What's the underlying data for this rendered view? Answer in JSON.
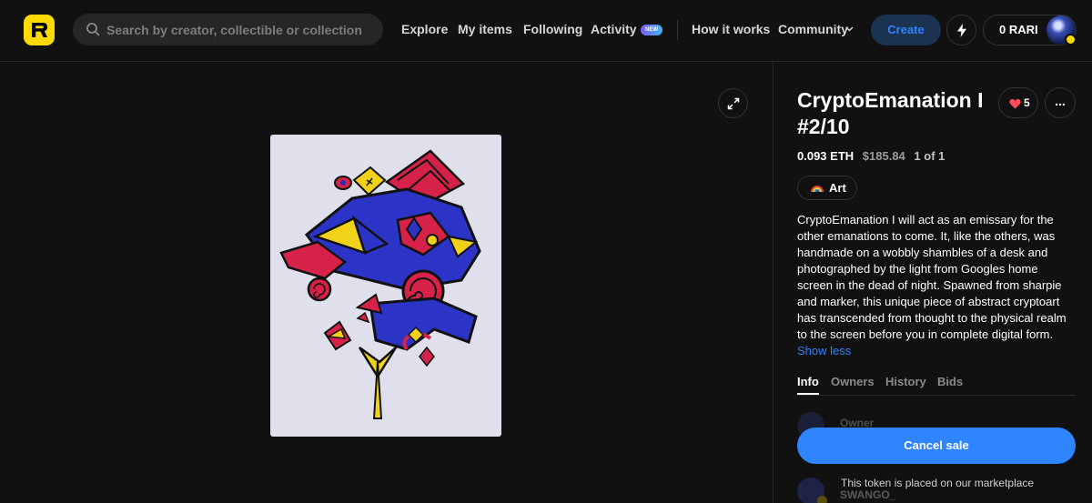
{
  "header": {
    "logo_icon": "rarible-logo-icon",
    "search": {
      "placeholder": "Search by creator, collectible or collection",
      "value": ""
    },
    "nav": {
      "explore": "Explore",
      "my_items": "My items",
      "following": "Following",
      "activity": "Activity",
      "activity_badge": "NEW",
      "how_it_works": "How it works",
      "community": "Community"
    },
    "create_label": "Create",
    "balance": "0 RARI"
  },
  "item": {
    "title": "CryptoEmanation I #2/10",
    "likes": "5",
    "more_label": "...",
    "price_eth": "0.093 ETH",
    "price_usd": "$185.84",
    "edition": "1 of 1",
    "category": "Art",
    "description": "CryptoEmanation I will act as an emissary for the other emanations to come. It, like the others, was handmade on a wobbly shambles of a desk and photographed by the light from Googles home screen in the dead of night. Spawned from sharpie and marker, this unique piece of abstract cryptoart has transcended from thought to the physical realm to the screen before you in complete digital form.",
    "show_less": "Show less"
  },
  "tabs": [
    "Info",
    "Owners",
    "History",
    "Bids"
  ],
  "active_tab": "Info",
  "owner": {
    "label": "Owner"
  },
  "creator": {
    "name": "SWANGO_"
  },
  "actions": {
    "cancel_sale": "Cancel sale",
    "market_note": "This token is placed on our marketplace"
  },
  "colors": {
    "accent": "#2f84ff",
    "brand": "#feda03",
    "background": "#111111",
    "like": "#ff4d5e"
  }
}
